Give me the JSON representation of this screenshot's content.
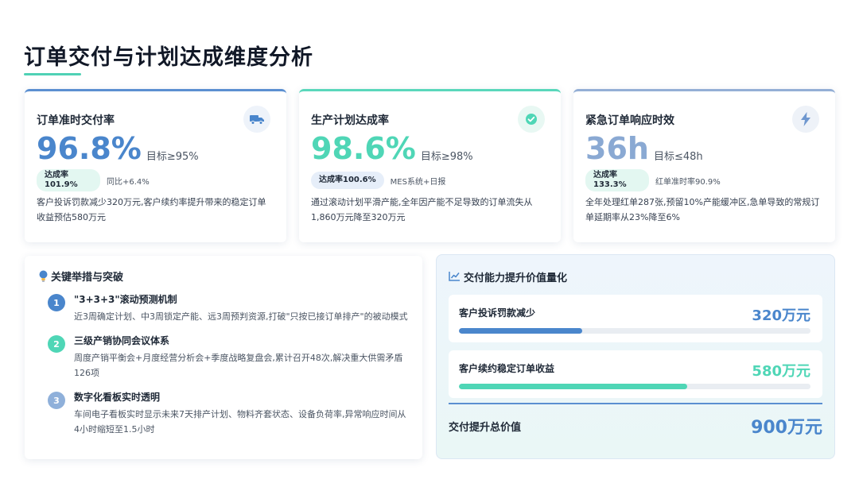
{
  "page": {
    "title": "订单交付与计划达成维度分析"
  },
  "kpis": [
    {
      "title": "订单准时交付率",
      "icon": "truck-icon",
      "value": "96.8%",
      "target": "目标≥95%",
      "badge": "达成率 101.9%",
      "note": "同比+6.4%",
      "desc": "客户投诉罚款减少320万元,客户续约率提升带来的稳定订单收益预估580万元"
    },
    {
      "title": "生产计划达成率",
      "icon": "check-circle-icon",
      "value": "98.6%",
      "target": "目标≥98%",
      "badge": "达成率100.6%",
      "note": "MES系统+日报",
      "desc": "通过滚动计划平滑产能,全年因产能不足导致的订单流失从1,860万元降至320万元"
    },
    {
      "title": "紧急订单响应时效",
      "icon": "lightning-icon",
      "value": "36h",
      "target": "目标≤48h",
      "badge": "达成率 133.3%",
      "note": "红单准时率90.9%",
      "desc": "全年处理红单287张,预留10%产能缓冲区,急单导致的常规订单延期率从23%降至6%"
    }
  ],
  "measures": {
    "heading": "关键举措与突破",
    "items": [
      {
        "num": "1",
        "title": "\"3+3+3\"滚动预测机制",
        "desc": "近3周确定计划、中3周锁定产能、远3周预判资源,打破\"只按已接订单排产\"的被动模式"
      },
      {
        "num": "2",
        "title": "三级产销协同会议体系",
        "desc": "周度产销平衡会+月度经营分析会+季度战略复盘会,累计召开48次,解决重大供需矛盾126项"
      },
      {
        "num": "3",
        "title": "数字化看板实时透明",
        "desc": "车间电子看板实时显示未来7天排产计划、物料齐套状态、设备负荷率,异常响应时间从4小时缩短至1.5小时"
      }
    ]
  },
  "value": {
    "heading": "交付能力提升价值量化",
    "items": [
      {
        "label": "客户投诉罚款减少",
        "amount": "320万元",
        "progress": 0.35
      },
      {
        "label": "客户续约稳定订单收益",
        "amount": "580万元",
        "progress": 0.65
      }
    ],
    "total_label": "交付提升总价值",
    "total_value": "900万元"
  },
  "colors": {
    "blue": "#4a86cc",
    "teal": "#4fd6b6",
    "light_blue": "#8aa9d3"
  }
}
